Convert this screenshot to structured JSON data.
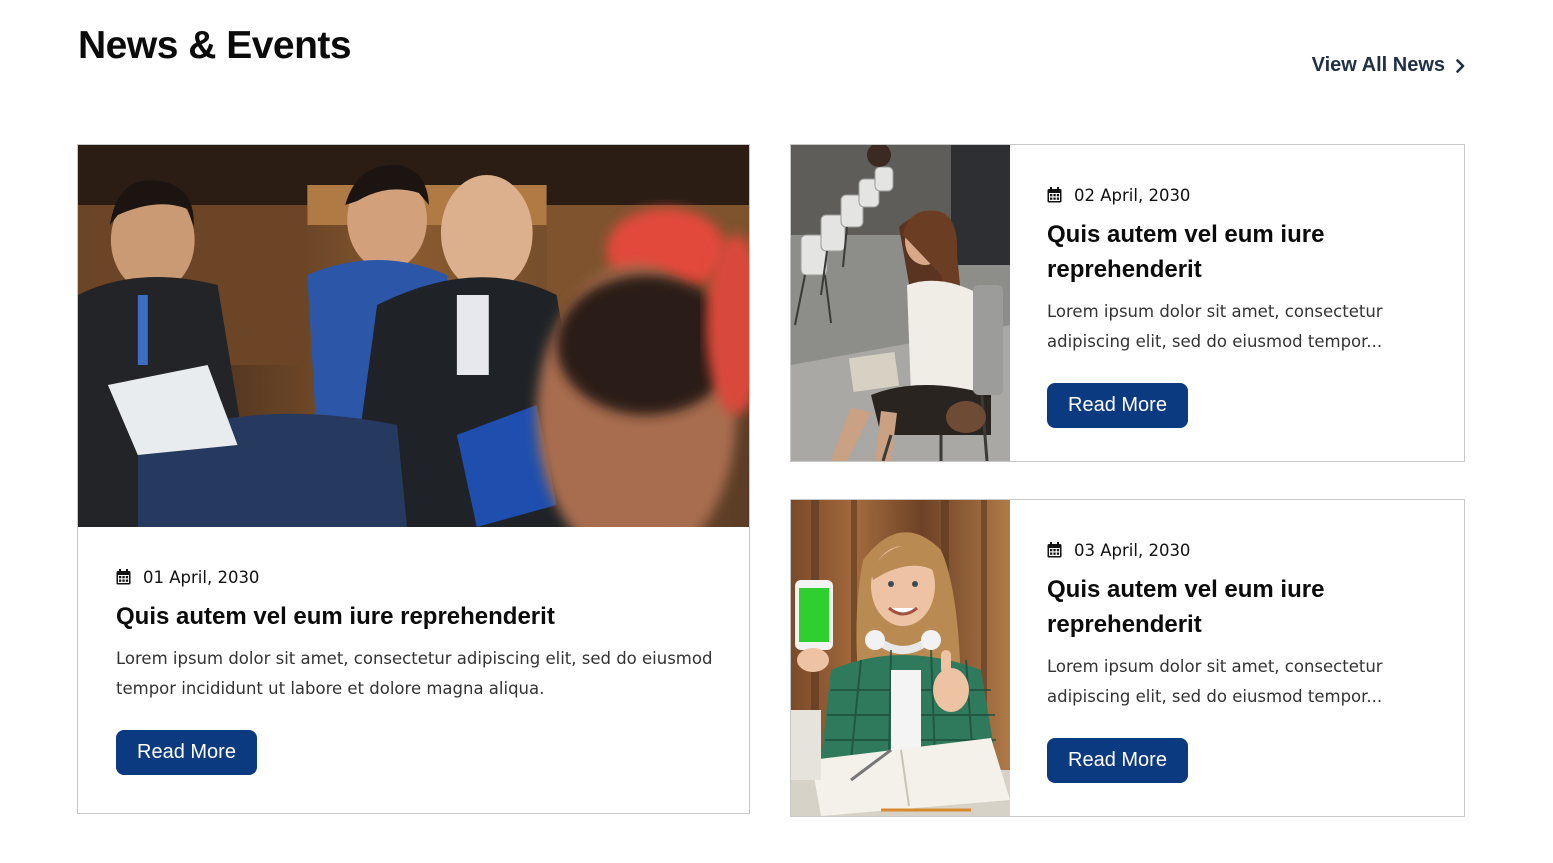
{
  "section": {
    "title": "News & Events",
    "view_all_label": "View All News"
  },
  "icons": {
    "date": "calendar-icon",
    "view_all": "chevron-right-icon"
  },
  "colors": {
    "button_bg": "#0b3a80",
    "title_text": "#0b0b0b",
    "link_text": "#1f2f45",
    "card_border": "#c8c8c8"
  },
  "articles": [
    {
      "image_alt": "Audience members seated in a lecture hall",
      "date": "01 April, 2030",
      "title": "Quis autem vel eum iure reprehenderit",
      "excerpt": "Lorem ipsum dolor sit amet, consectetur adipiscing elit, sed do eiusmod tempor incididunt ut labore et dolore magna aliqua.",
      "button_label": "Read More"
    },
    {
      "image_alt": "Student reading a book on a folding chair",
      "date": "02 April, 2030",
      "title": "Quis autem vel eum iure reprehenderit",
      "excerpt": "Lorem ipsum dolor sit amet, consectetur adipiscing elit, sed do eiusmod tempor...",
      "button_label": "Read More"
    },
    {
      "image_alt": "Smiling student holding a phone and giving a thumbs up",
      "date": "03 April, 2030",
      "title": "Quis autem vel eum iure reprehenderit",
      "excerpt": "Lorem ipsum dolor sit amet, consectetur adipiscing elit, sed do eiusmod tempor...",
      "button_label": "Read More"
    }
  ]
}
